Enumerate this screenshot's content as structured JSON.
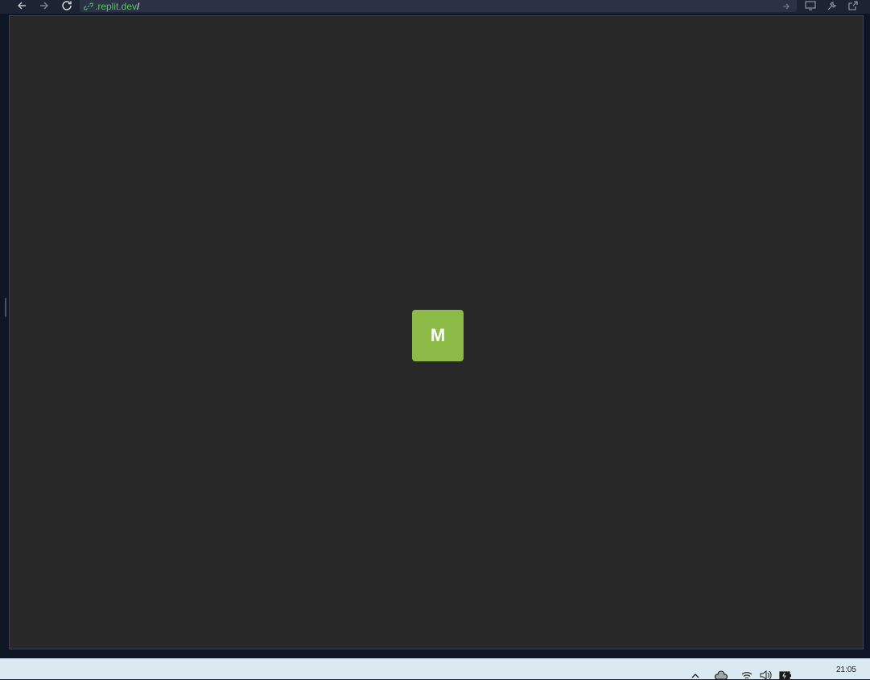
{
  "browser": {
    "url_domain": ".replit.dev",
    "url_path": "/"
  },
  "preview": {
    "tile_letter": "M",
    "tile_color": "#8bbb46",
    "background_color": "#282828"
  },
  "taskbar": {
    "clock": "21:05"
  }
}
